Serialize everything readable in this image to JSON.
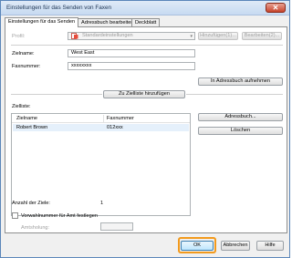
{
  "window": {
    "title": "Einstellungen für das Senden von Faxen",
    "close_glyph": "✕"
  },
  "tabs": [
    {
      "label": "Einstellungen für das Senden",
      "active": true
    },
    {
      "label": "Adressbuch bearbeiten",
      "active": false
    },
    {
      "label": "Deckblatt",
      "active": false
    }
  ],
  "profile": {
    "label": "Profil:",
    "value": "Standardeinstellungen",
    "add_button": "Hinzufügen(1)...",
    "edit_button": "Bearbeiten(2)..."
  },
  "recipient": {
    "name_label": "Zielname:",
    "name_value": "West East",
    "fax_label": "Faxnummer:",
    "fax_value": "xxxxxxxx",
    "add_to_addressbook_button": "In Adressbuch aufnehmen",
    "add_to_list_button": "Zu Zielliste hinzufügen"
  },
  "destination_list": {
    "label": "Zielliste:",
    "columns": [
      "Zielname",
      "Faxnummer"
    ],
    "rows": [
      {
        "name": "Robert Brown",
        "fax": "012xxx"
      }
    ],
    "addressbook_button": "Adressbuch...",
    "delete_button": "Löschen"
  },
  "destination_count": {
    "label": "Anzahl der Ziele:",
    "value": "1"
  },
  "prefix": {
    "checkbox_label": "Vorwahlnummer für Amt festlegen",
    "field_label": "Amtsholung:",
    "field_value": ""
  },
  "footer": {
    "ok": "OK",
    "cancel": "Abbrechen",
    "help": "Hilfe"
  },
  "colors": {
    "highlight": "#f29a1d",
    "accent": "#3c7fb1"
  }
}
